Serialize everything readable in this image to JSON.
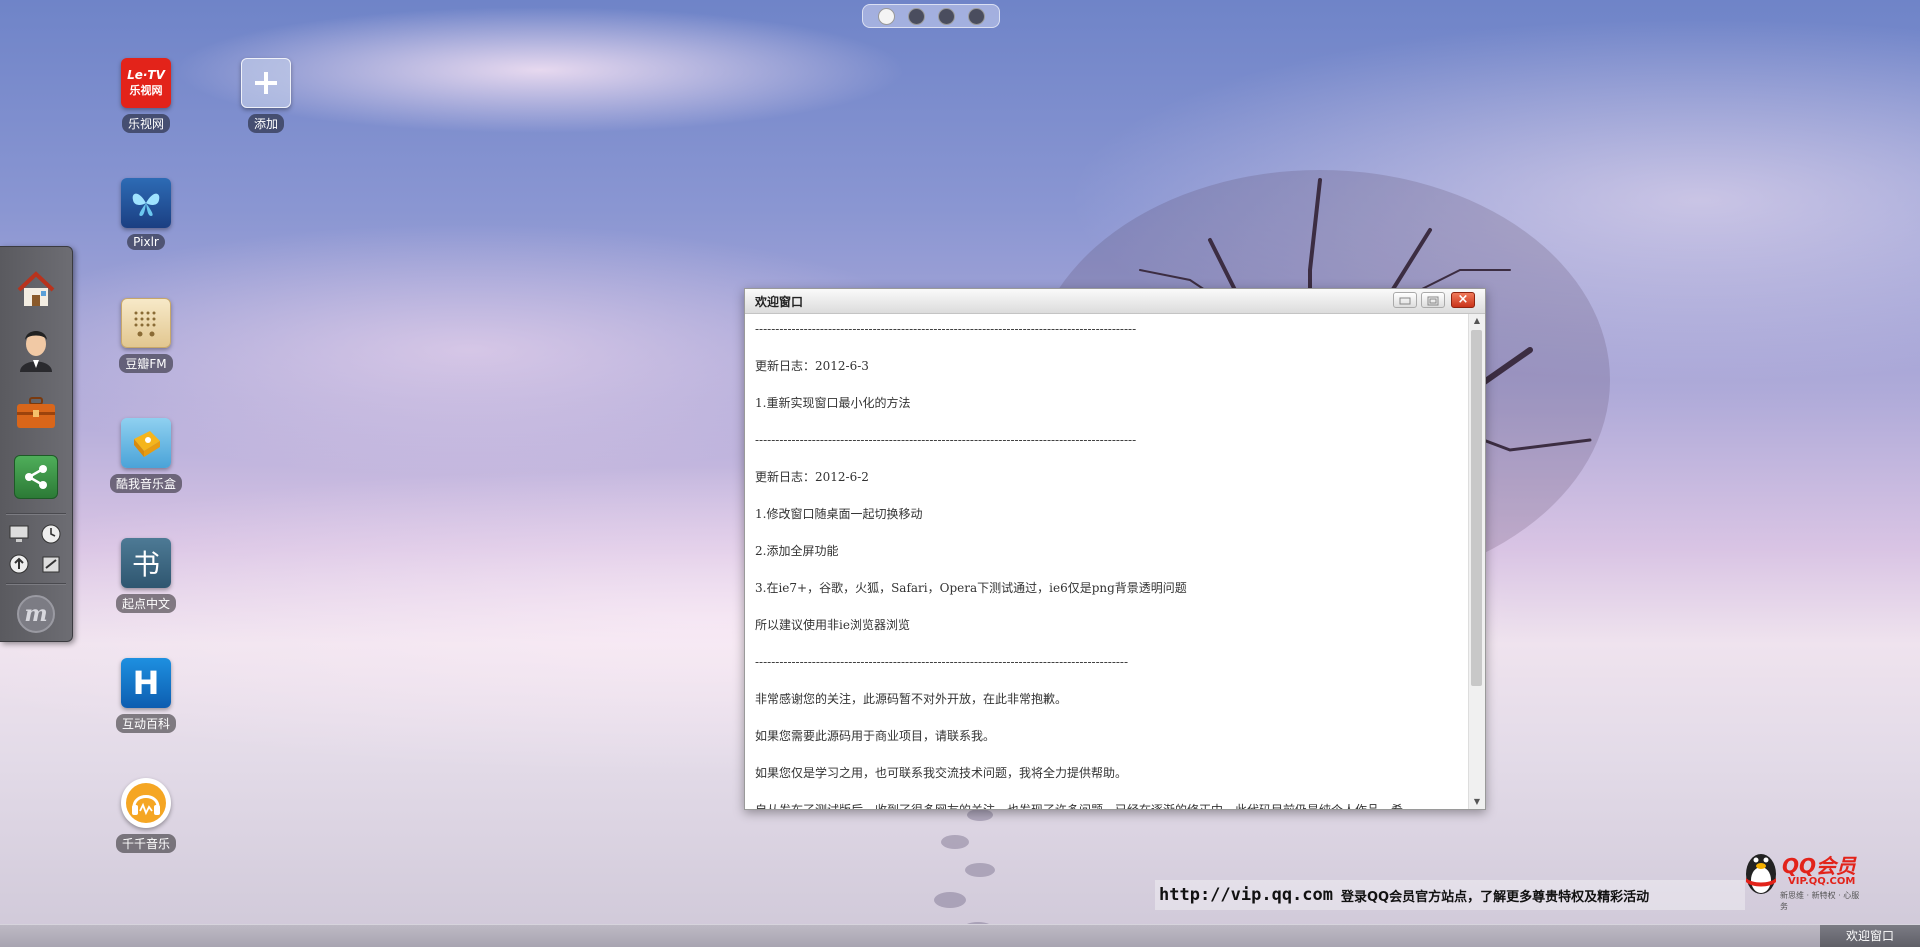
{
  "desktop": {
    "page_count": 4,
    "active_page": 1,
    "icons": [
      {
        "label": "乐视网",
        "icon": "letv-icon",
        "logo_text_top": "Le·TV",
        "logo_text_bottom": "乐视网"
      },
      {
        "label": "添加",
        "icon": "add-icon"
      },
      {
        "label": "Pixlr",
        "icon": "pixlr-icon"
      },
      {
        "label": "豆瓣FM",
        "icon": "radio-icon"
      },
      {
        "label": "酷我音乐盒",
        "icon": "music-box-icon"
      },
      {
        "label": "起点中文",
        "icon": "book-icon",
        "glyph": "书"
      },
      {
        "label": "互动百科",
        "icon": "hudong-icon",
        "glyph": "H"
      },
      {
        "label": "千千音乐",
        "icon": "headphones-icon"
      }
    ]
  },
  "dock": {
    "items": [
      "home-icon",
      "avatar-icon",
      "briefcase-icon",
      "share-icon"
    ],
    "small_items": [
      "monitor-icon",
      "clock-icon",
      "upload-icon",
      "settings-icon"
    ],
    "footer_logo": "m-logo-icon",
    "footer_glyph": "m"
  },
  "window": {
    "title": "欢迎窗口",
    "close_glyph": "×",
    "lines": [
      "----------------------------------------------------------------------------------------------",
      "更新日志：2012-6-3",
      "1.重新实现窗口最小化的方法",
      "----------------------------------------------------------------------------------------------",
      "更新日志：2012-6-2",
      "1.修改窗口随桌面一起切换移动",
      "2.添加全屏功能",
      "3.在ie7+，谷歌，火狐，Safari，Opera下测试通过，ie6仅是png背景透明问题",
      "所以建议使用非ie浏览器浏览",
      "--------------------------------------------------------------------------------------------",
      "非常感谢您的关注，此源码暂不对外开放，在此非常抱歉。",
      "如果您需要此源码用于商业项目，请联系我。",
      "如果您仅是学习之用，也可联系我交流技术问题，我将全力提供帮助。",
      "自从发布了测试版后，收到了很多网友的关注，也发现了许多问题，已经在逐渐的修正中，此代码目前仍是纯个人作品，希"
    ]
  },
  "vip": {
    "url": "http://vip.qq.com",
    "text": "登录QQ会员官方站点，了解更多尊贵特权及精彩活动",
    "brand": "QQ会员",
    "brand_url": "VIP.QQ.COM",
    "tagline": "新思维 · 新特权 · 心服务"
  },
  "taskbar": {
    "items": [
      "欢迎窗口"
    ]
  },
  "colors": {
    "close_button": "#d7401f",
    "label_bg": "rgba(0,0,0,0.45)"
  }
}
